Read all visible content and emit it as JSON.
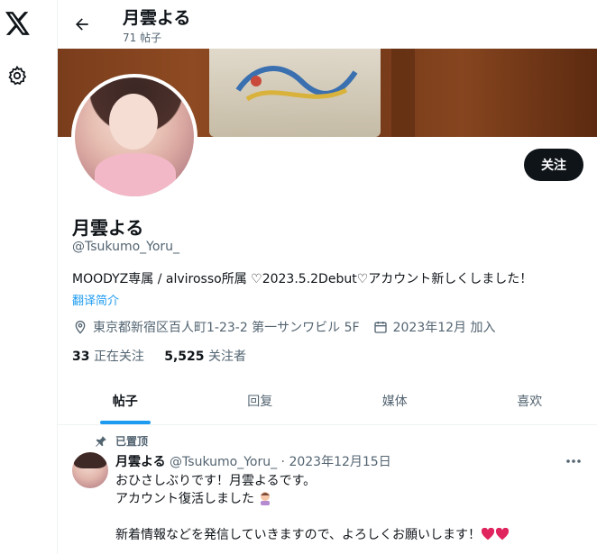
{
  "topbar": {
    "title": "月雲よる",
    "subtitle": "71 帖子"
  },
  "nav": {
    "logo_icon": "x-logo-icon",
    "settings_icon": "gear-icon"
  },
  "profile": {
    "follow_label": "关注",
    "name": "月雲よる",
    "handle": "@Tsukumo_Yoru_",
    "bio": "MOODYZ専属 / alvirosso所属 ♡2023.5.2Debut♡アカウント新しくしました！",
    "translate_label": "翻译简介",
    "location": "東京都新宿区百人町1-23-2 第一サンワビル 5F",
    "joined": "2023年12月 加入",
    "following_count": "33",
    "following_label": "正在关注",
    "followers_count": "5,525",
    "followers_label": "关注者"
  },
  "tabs": [
    {
      "label": "帖子"
    },
    {
      "label": "回复"
    },
    {
      "label": "媒体"
    },
    {
      "label": "喜欢"
    }
  ],
  "post": {
    "pinned_label": "已置顶",
    "author_name": "月雲よる",
    "author_handle": "@Tsukumo_Yoru_",
    "separator": "·",
    "date": "2023年12月15日",
    "lines": [
      "おひさしぶりです！月雲よるです。",
      "アカウント復活しました",
      "",
      "新着情報などを発信していきますので、よろしくお願いします！"
    ]
  },
  "colors": {
    "accent": "#1d9bf0",
    "text": "#0f1419",
    "muted": "#536471",
    "heart": "#e0245e"
  }
}
